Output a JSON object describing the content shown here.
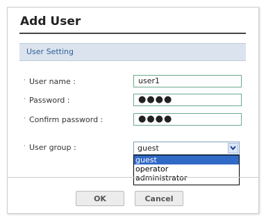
{
  "dialog": {
    "title": "Add User",
    "section_title": "User Setting"
  },
  "form": {
    "bullet": "·",
    "fields": [
      {
        "label": "User name :",
        "value": "user1"
      },
      {
        "label": "Password :",
        "value": "●●●●"
      },
      {
        "label": "Confirm password :",
        "value": "●●●●"
      },
      {
        "label": "User group :",
        "value": "guest"
      }
    ]
  },
  "user_group_dropdown": {
    "selected": "guest",
    "options": [
      "guest",
      "operator",
      "administrator"
    ],
    "highlight_color": "#3169c6"
  },
  "buttons": {
    "ok": "OK",
    "cancel": "Cancel"
  },
  "colors": {
    "section_bg": "#dbe3ee",
    "section_text": "#2d5f99",
    "field_border": "#6aa88b"
  }
}
